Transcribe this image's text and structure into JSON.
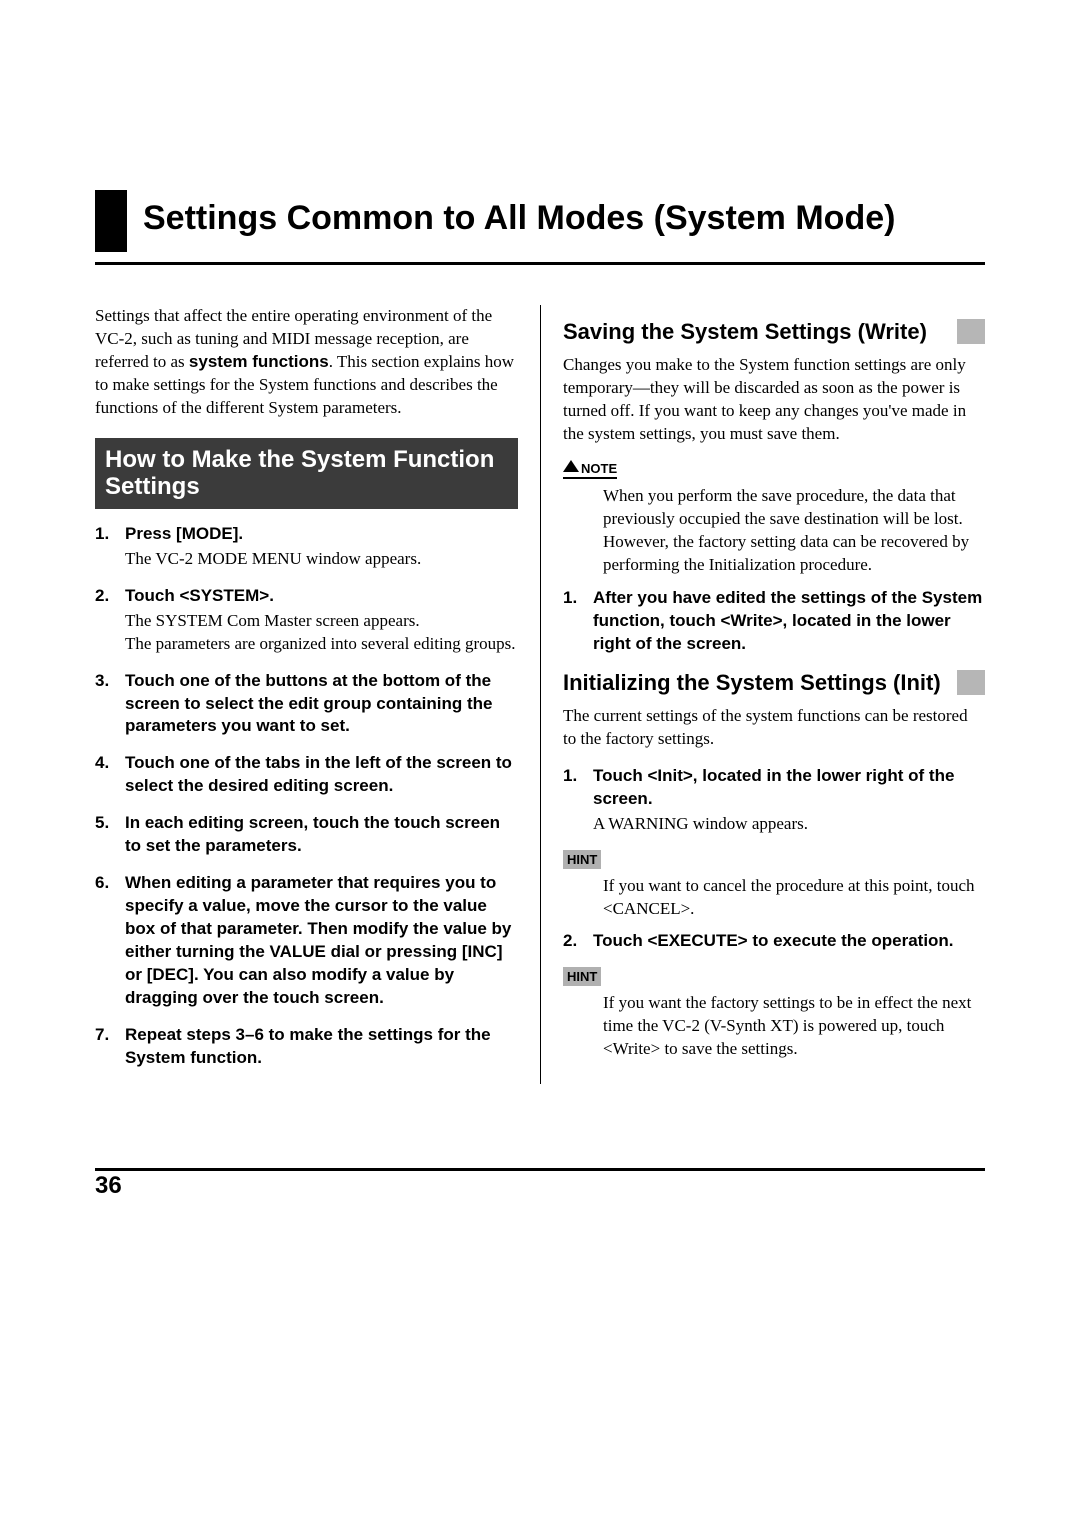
{
  "page_number": "36",
  "title": "Settings Common to All Modes (System Mode)",
  "intro": {
    "pre": "Settings that affect the entire operating environment of the VC-2, such as tuning and MIDI message reception, are referred to as ",
    "bold": "system functions",
    "post": ". This section explains how to make settings for the System functions and describes the functions of the different System parameters."
  },
  "left": {
    "heading": "How to Make the System Function Settings",
    "steps": [
      {
        "num": "1.",
        "title": "Press [MODE].",
        "body": "The VC-2 MODE MENU window appears."
      },
      {
        "num": "2.",
        "title": "Touch <SYSTEM>.",
        "body": "The SYSTEM Com Master screen appears.\nThe parameters are organized into several editing groups."
      },
      {
        "num": "3.",
        "title": "Touch one of the buttons at the bottom of the screen to select the edit group containing the parameters you want to set."
      },
      {
        "num": "4.",
        "title": "Touch one of the tabs in the left of the screen to select the desired editing screen."
      },
      {
        "num": "5.",
        "title": "In each editing screen, touch the touch screen to set the parameters."
      },
      {
        "num": "6.",
        "title": "When editing a parameter that requires you to specify a value, move the cursor to the value box of that parameter. Then modify the value by either turning the VALUE dial or pressing [INC] or [DEC]. You can also modify a value by dragging over the touch screen."
      },
      {
        "num": "7.",
        "title": "Repeat steps 3–6 to make the settings for the System function."
      }
    ]
  },
  "right": {
    "save": {
      "heading": "Saving the System Settings (Write)",
      "intro": "Changes you make to the System function settings are only temporary—they will be discarded as soon as the power is turned off. If you want to keep any changes you've made in the system settings, you must save them.",
      "note_label": "NOTE",
      "note_text": "When you perform the save procedure, the data that previously occupied the save destination will be lost. However, the factory setting data can be recovered by performing the Initialization procedure.",
      "steps": [
        {
          "num": "1.",
          "title": "After you have edited the settings of the System function, touch <Write>, located in the lower right of the screen."
        }
      ]
    },
    "init": {
      "heading": "Initializing the System Settings (Init)",
      "intro": "The current settings of the system functions can be restored to the factory settings.",
      "steps": [
        {
          "num": "1.",
          "title": "Touch <Init>, located in the lower right of the screen.",
          "body": "A WARNING window appears."
        }
      ],
      "hint1_label": "HINT",
      "hint1_text": "If you want to cancel the procedure at this point, touch <CANCEL>.",
      "steps2": [
        {
          "num": "2.",
          "title": "Touch <EXECUTE> to execute the operation."
        }
      ],
      "hint2_label": "HINT",
      "hint2_text": "If you want the factory settings to be in effect the next time the VC-2 (V-Synth XT) is powered up, touch <Write> to save the settings."
    }
  }
}
